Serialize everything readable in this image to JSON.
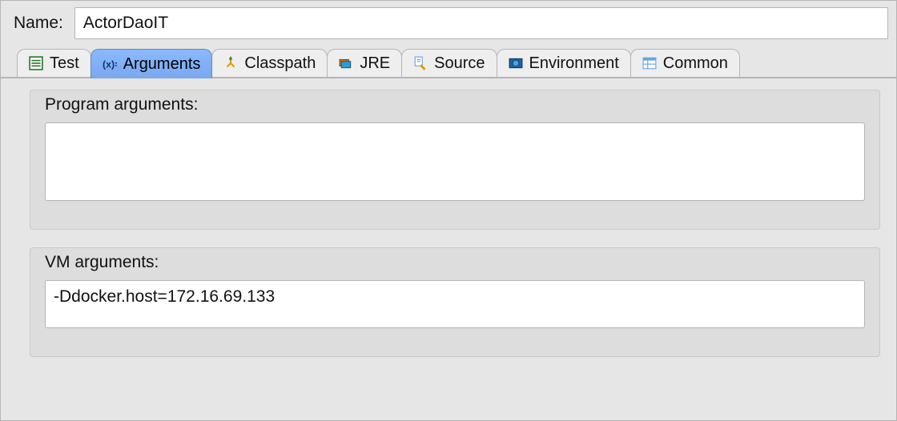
{
  "fields": {
    "name_label": "Name:",
    "name_value": "ActorDaoIT"
  },
  "tabs": {
    "test": "Test",
    "arguments": "Arguments",
    "classpath": "Classpath",
    "jre": "JRE",
    "source": "Source",
    "environment": "Environment",
    "common": "Common",
    "active": "arguments"
  },
  "arguments_tab": {
    "program_label": "Program arguments:",
    "program_value": "",
    "vm_label": "VM arguments:",
    "vm_value": "-Ddocker.host=172.16.69.133"
  }
}
